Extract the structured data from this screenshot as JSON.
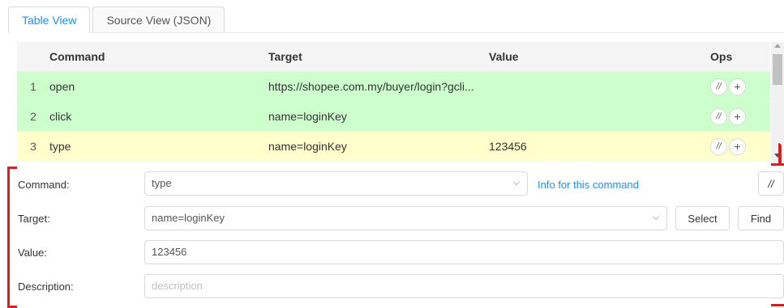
{
  "tabs": [
    {
      "label": "Table View",
      "active": true
    },
    {
      "label": "Source View (JSON)",
      "active": false
    }
  ],
  "table": {
    "headers": {
      "command": "Command",
      "target": "Target",
      "value": "Value",
      "ops": "Ops"
    },
    "rows": [
      {
        "index": "1",
        "command": "open",
        "target": "https://shopee.com.my/buyer/login?gcli...",
        "value": "",
        "status": "green"
      },
      {
        "index": "2",
        "command": "click",
        "target": "name=loginKey",
        "value": "",
        "status": "green"
      },
      {
        "index": "3",
        "command": "type",
        "target": "name=loginKey",
        "value": "123456",
        "status": "yellow"
      }
    ],
    "ops": {
      "comment_label": "//",
      "add_label": "+"
    }
  },
  "editor": {
    "command_label": "Command:",
    "command_value": "type",
    "info_link": "Info for this command",
    "comment_button": "//",
    "target_label": "Target:",
    "target_value": "name=loginKey",
    "select_button": "Select",
    "find_button": "Find",
    "value_label": "Value:",
    "value_value": "123456",
    "description_label": "Description:",
    "description_placeholder": "description"
  },
  "colors": {
    "accent": "#1890ff",
    "row_green": "#ccffcc",
    "row_yellow": "#ffffcc",
    "annotation_red": "#d42020"
  }
}
